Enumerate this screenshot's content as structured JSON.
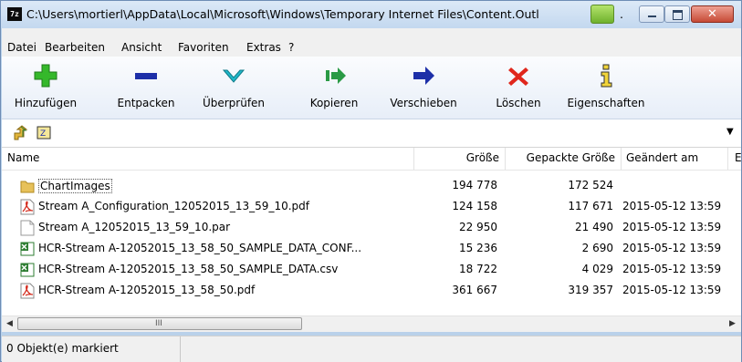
{
  "window": {
    "title": "C:\\Users\\mortierl\\AppData\\Local\\Microsoft\\Windows\\Temporary Internet Files\\Content.Outl",
    "title_ellipsis": ".",
    "app_icon_text": "7z",
    "close_glyph": "✕"
  },
  "menu": [
    "Datei",
    "Bearbeiten",
    "Ansicht",
    "Favoriten",
    "Extras",
    "?"
  ],
  "toolbar": {
    "add": "Hinzufügen",
    "extract": "Entpacken",
    "test": "Überprüfen",
    "copy": "Kopieren",
    "move": "Verschieben",
    "delete": "Löschen",
    "info": "Eigenschaften",
    "colors": {
      "add": "#35b82b",
      "extract": "#1d2fa8",
      "test": "#1fb7c9",
      "copy": "#2a9a45",
      "move": "#1d2fa8",
      "delete": "#e0261c",
      "info": "#2f2f2f"
    }
  },
  "address": {
    "value": "",
    "dropdown_glyph": "▼"
  },
  "columns": {
    "name": "Name",
    "size": "Größe",
    "packed": "Gepackte Größe",
    "modified": "Geändert am",
    "extra": "E"
  },
  "files": [
    {
      "name": "ChartImages",
      "size": "194 778",
      "packed": "172 524",
      "modified": "",
      "icon": "folder-icon"
    },
    {
      "name": "Stream A_Configuration_12052015_13_59_10.pdf",
      "size": "124 158",
      "packed": "117 671",
      "modified": "2015-05-12 13:59",
      "icon": "pdf-icon"
    },
    {
      "name": "Stream A_12052015_13_59_10.par",
      "size": "22 950",
      "packed": "21 490",
      "modified": "2015-05-12 13:59",
      "icon": "blank-file-icon"
    },
    {
      "name": "HCR-Stream A-12052015_13_58_50_SAMPLE_DATA_CONF...",
      "size": "15 236",
      "packed": "2 690",
      "modified": "2015-05-12 13:59",
      "icon": "excel-icon"
    },
    {
      "name": "HCR-Stream A-12052015_13_58_50_SAMPLE_DATA.csv",
      "size": "18 722",
      "packed": "4 029",
      "modified": "2015-05-12 13:59",
      "icon": "excel-icon"
    },
    {
      "name": "HCR-Stream A-12052015_13_58_50.pdf",
      "size": "361 667",
      "packed": "319 357",
      "modified": "2015-05-12 13:59",
      "icon": "pdf-icon"
    }
  ],
  "scrollbar": {
    "left_arrow": "◀",
    "right_arrow": "▶",
    "grip": "III"
  },
  "status": {
    "text": "0 Objekt(e) markiert"
  }
}
